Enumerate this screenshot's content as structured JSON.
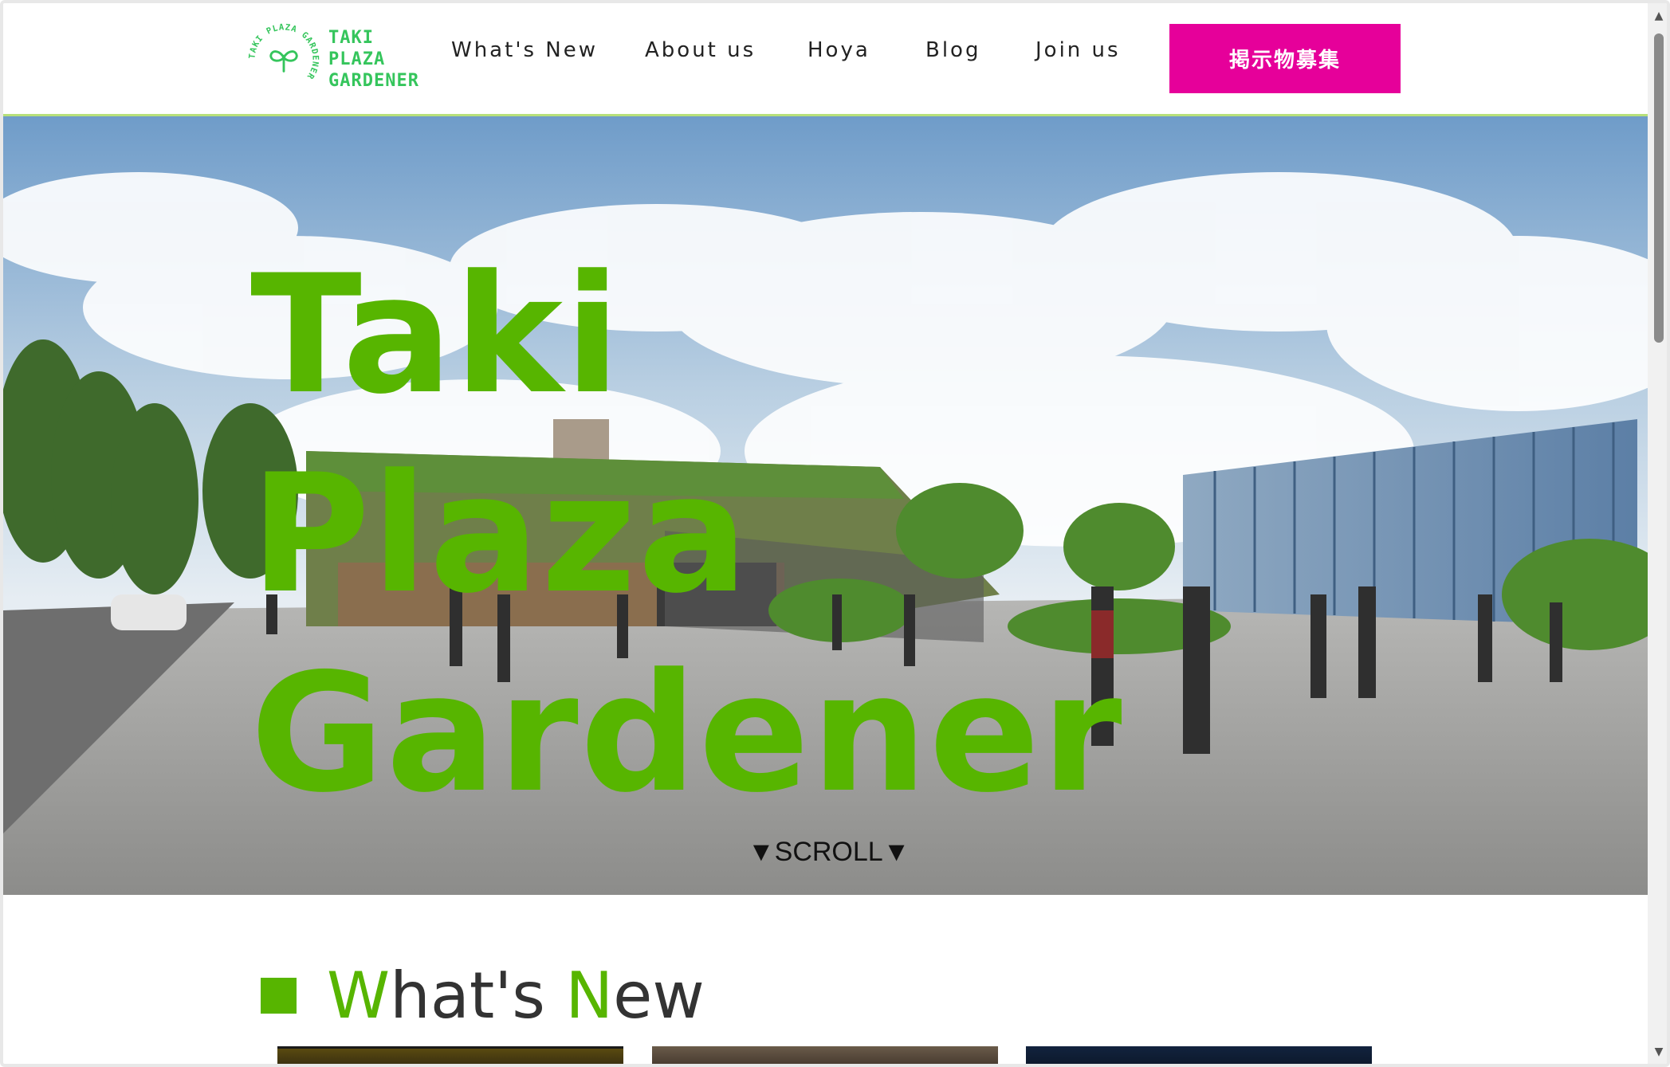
{
  "logo": {
    "ring_text": "TAKI PLAZA GARDENER",
    "lines": [
      "TAKI",
      "PLAZA",
      "GARDENER"
    ]
  },
  "nav": {
    "items": [
      {
        "label": "What's New"
      },
      {
        "label": "About us"
      },
      {
        "label": "Hoya"
      },
      {
        "label": "Blog"
      },
      {
        "label": "Join us"
      }
    ],
    "cta_label": "掲示物募集"
  },
  "hero": {
    "title_lines": [
      "Taki",
      "Plaza",
      "Gardener"
    ],
    "scroll_label": "▼SCROLL▼"
  },
  "whats_new": {
    "title_first_initial": "W",
    "title_first_rest": "hat's ",
    "title_second_initial": "N",
    "title_second_rest": "ew"
  },
  "colors": {
    "brand_green": "#57b500",
    "logo_green": "#35c55c",
    "cta_magenta": "#e6009a",
    "header_border": "#b7e07a"
  },
  "icons": [
    "sprout-icon",
    "scroll-down-arrow-icon"
  ]
}
